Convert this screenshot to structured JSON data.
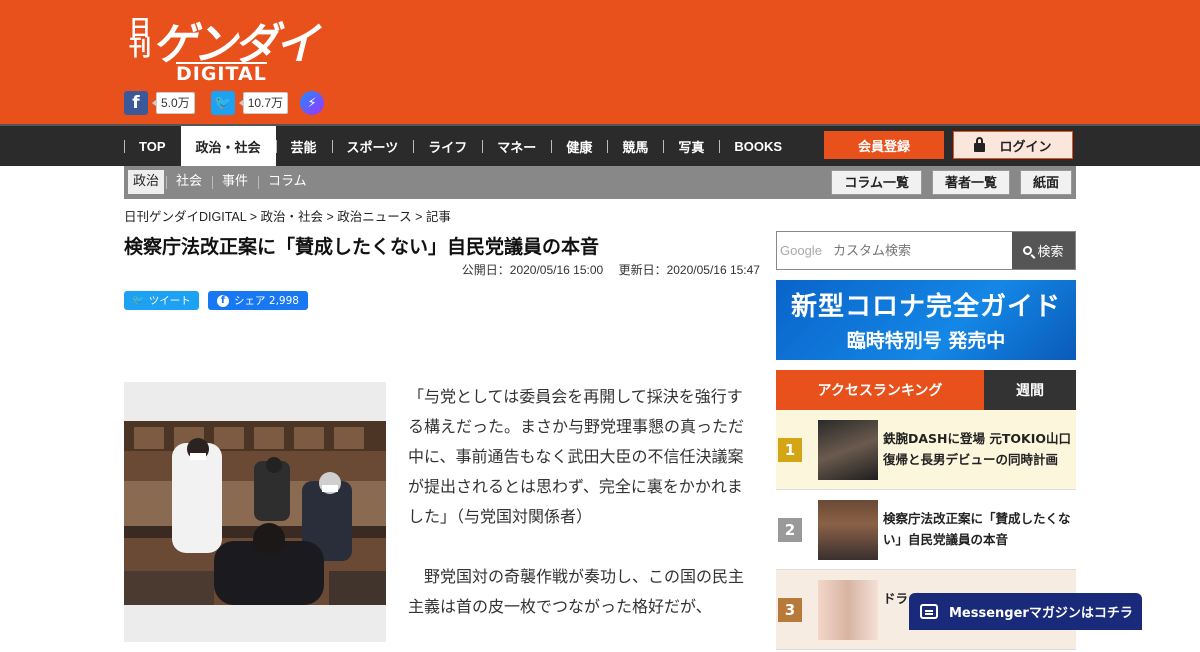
{
  "header": {
    "logo_nikkan": "日刊",
    "logo_brand": "ゲンダイ",
    "logo_digital": "DIGITAL",
    "social": {
      "facebook_count": "5.0万",
      "twitter_count": "10.7万"
    },
    "icons": [
      "facebook-icon",
      "twitter-icon",
      "messenger-icon"
    ],
    "brand_color": "#e8511c"
  },
  "nav": {
    "items": [
      {
        "label": "TOP"
      },
      {
        "label": "政治・社会"
      },
      {
        "label": "芸能"
      },
      {
        "label": "スポーツ"
      },
      {
        "label": "ライフ"
      },
      {
        "label": "マネー"
      },
      {
        "label": "健康"
      },
      {
        "label": "競馬"
      },
      {
        "label": "写真"
      },
      {
        "label": "BOOKS"
      }
    ],
    "active": "政治・社会",
    "register_label": "会員登録",
    "login_label": "ログイン"
  },
  "subnav": {
    "items": [
      {
        "label": "政治"
      },
      {
        "label": "社会"
      },
      {
        "label": "事件"
      },
      {
        "label": "コラム"
      }
    ],
    "active": "政治",
    "buttons": [
      {
        "label": "コラム一覧"
      },
      {
        "label": "著者一覧"
      },
      {
        "label": "紙面"
      }
    ]
  },
  "breadcrumb": "日刊ゲンダイDIGITAL > 政治・社会 > 政治ニュース > 記事",
  "article": {
    "title": "検察庁法改正案に「賛成したくない」自民党議員の本音",
    "published": "公開日：2020/05/16 15:00",
    "updated": "更新日：2020/05/16 15:47",
    "tweet_label": "ツイート",
    "share_label": "シェア 2,998",
    "paragraphs": [
      "「与党としては委員会を再開して採決を強行する構えだった。まさか与野党理事懇の真っただ中に、事前通告もなく武田大臣の不信任決議案が提出されるとは思わず、完全に裏をかかれました」（与党国対関係者）",
      "　野党国対の奇襲作戦が奏功し、この国の民主主義は首の皮一枚でつながった格好だが、"
    ]
  },
  "sidebar": {
    "search": {
      "google_label": "Google",
      "placeholder": "カスタム検索",
      "button_label": "検索"
    },
    "banner": {
      "line1": "新型コロナ完全ガイド",
      "line2": "臨時特別号 発売中"
    },
    "ranking": {
      "title": "アクセスランキング",
      "period": "週間",
      "items": [
        {
          "rank": "1",
          "title": "鉄腕DASHに登場 元TOKIO山口 復帰と長男デビューの同時計画"
        },
        {
          "rank": "2",
          "title": "検察庁法改正案に「賛成したくない」自民党議員の本音"
        },
        {
          "rank": "3",
          "title": "ドラ キー"
        }
      ]
    }
  },
  "messenger_bar": "Messengerマガジンはコチラ"
}
